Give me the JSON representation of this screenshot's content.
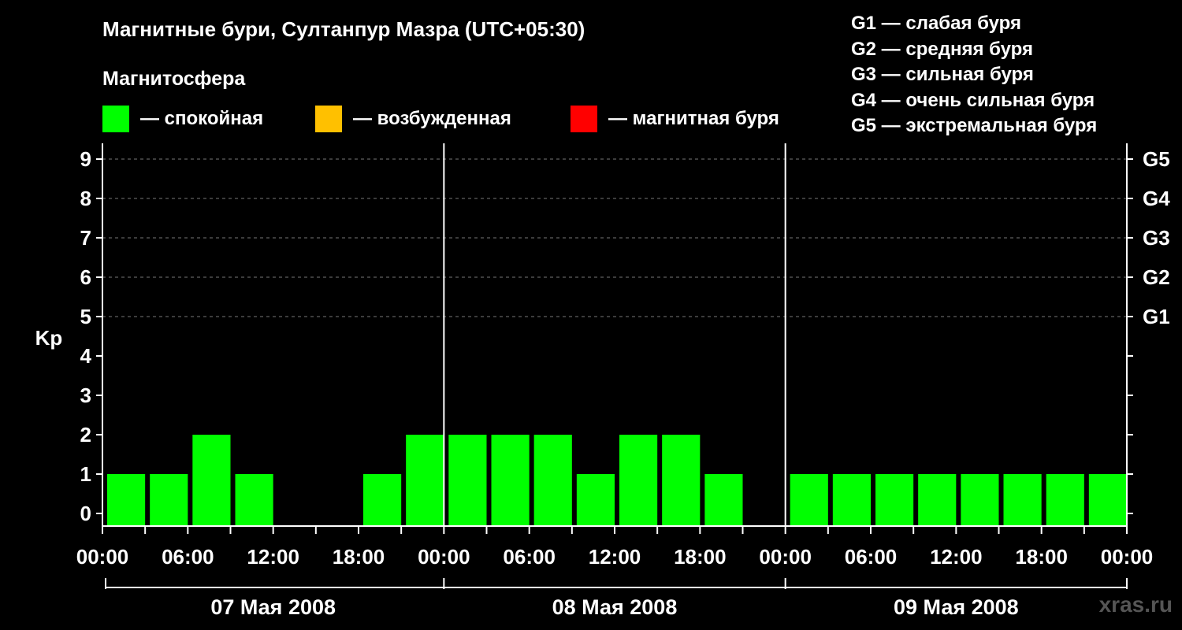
{
  "title": "Магнитные бури, Султанпур Мазра (UTC+05:30)",
  "subtitle": "Магнитосфера",
  "legend": [
    {
      "color": "#00ff00",
      "label": "— спокойная"
    },
    {
      "color": "#ffc000",
      "label": "— возбужденная"
    },
    {
      "color": "#ff0000",
      "label": "— магнитная буря"
    }
  ],
  "storm_scale": [
    "G1 — слабая буря",
    "G2 — средняя буря",
    "G3 — сильная буря",
    "G4 — очень сильная буря",
    "G5 — экстремальная буря"
  ],
  "watermark": "xras.ru",
  "chart_data": {
    "type": "bar",
    "ylabel": "Kp",
    "ylim": [
      0,
      9
    ],
    "yticks": [
      0,
      1,
      2,
      3,
      4,
      5,
      6,
      7,
      8,
      9
    ],
    "right_ticks": [
      {
        "value": 5,
        "label": "G1"
      },
      {
        "value": 6,
        "label": "G2"
      },
      {
        "value": 7,
        "label": "G3"
      },
      {
        "value": 8,
        "label": "G4"
      },
      {
        "value": 9,
        "label": "G5"
      }
    ],
    "grid": "dashed horizontal at 5–9",
    "time_unit_hours": 3,
    "xtick_labels": [
      "00:00",
      "06:00",
      "12:00",
      "18:00",
      "00:00",
      "06:00",
      "12:00",
      "18:00",
      "00:00",
      "06:00",
      "12:00",
      "18:00",
      "00:00"
    ],
    "dates": [
      "07 Мая 2008",
      "08 Мая 2008",
      "09 Мая 2008"
    ],
    "bars": [
      {
        "day": "07 Мая 2008",
        "slot": 0,
        "value": 1,
        "color": "#00ff00"
      },
      {
        "day": "07 Мая 2008",
        "slot": 1,
        "value": 1,
        "color": "#00ff00"
      },
      {
        "day": "07 Мая 2008",
        "slot": 2,
        "value": 2,
        "color": "#00ff00"
      },
      {
        "day": "07 Мая 2008",
        "slot": 3,
        "value": 1,
        "color": "#00ff00"
      },
      {
        "day": "07 Мая 2008",
        "slot": 6,
        "value": 1,
        "color": "#00ff00"
      },
      {
        "day": "07 Мая 2008",
        "slot": 7,
        "value": 2,
        "color": "#00ff00"
      },
      {
        "day": "08 Мая 2008",
        "slot": 0,
        "value": 2,
        "color": "#00ff00"
      },
      {
        "day": "08 Мая 2008",
        "slot": 1,
        "value": 2,
        "color": "#00ff00"
      },
      {
        "day": "08 Мая 2008",
        "slot": 2,
        "value": 2,
        "color": "#00ff00"
      },
      {
        "day": "08 Мая 2008",
        "slot": 3,
        "value": 1,
        "color": "#00ff00"
      },
      {
        "day": "08 Мая 2008",
        "slot": 4,
        "value": 2,
        "color": "#00ff00"
      },
      {
        "day": "08 Мая 2008",
        "slot": 5,
        "value": 2,
        "color": "#00ff00"
      },
      {
        "day": "08 Мая 2008",
        "slot": 6,
        "value": 1,
        "color": "#00ff00"
      },
      {
        "day": "09 Мая 2008",
        "slot": 0,
        "value": 1,
        "color": "#00ff00"
      },
      {
        "day": "09 Мая 2008",
        "slot": 1,
        "value": 1,
        "color": "#00ff00"
      },
      {
        "day": "09 Мая 2008",
        "slot": 2,
        "value": 1,
        "color": "#00ff00"
      },
      {
        "day": "09 Мая 2008",
        "slot": 3,
        "value": 1,
        "color": "#00ff00"
      },
      {
        "day": "09 Мая 2008",
        "slot": 4,
        "value": 1,
        "color": "#00ff00"
      },
      {
        "day": "09 Мая 2008",
        "slot": 5,
        "value": 1,
        "color": "#00ff00"
      },
      {
        "day": "09 Мая 2008",
        "slot": 6,
        "value": 1,
        "color": "#00ff00"
      },
      {
        "day": "09 Мая 2008",
        "slot": 7,
        "value": 1,
        "color": "#00ff00"
      }
    ]
  }
}
